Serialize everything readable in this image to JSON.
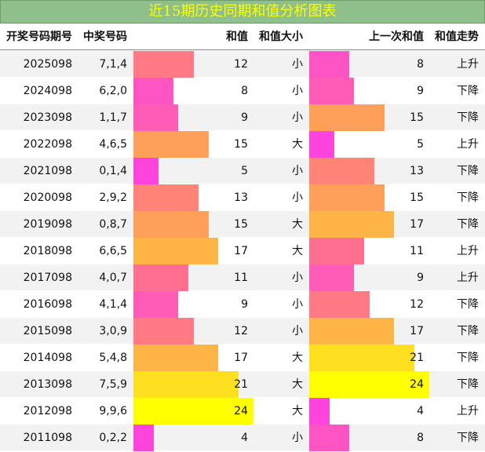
{
  "title": "近15期历史同期和值分析图表",
  "headers": {
    "period": "开奖号码期号",
    "numbers": "中奖号码",
    "sum": "和值",
    "size": "和值大小",
    "prev_sum": "上一次和值",
    "trend": "和值走势"
  },
  "bar_scale_max": 24,
  "rows": [
    {
      "period": "2025098",
      "numbers": "7,1,4",
      "sum": 12,
      "size": "小",
      "prev_sum": 8,
      "trend": "上升"
    },
    {
      "period": "2024098",
      "numbers": "6,2,0",
      "sum": 8,
      "size": "小",
      "prev_sum": 9,
      "trend": "下降"
    },
    {
      "period": "2023098",
      "numbers": "1,1,7",
      "sum": 9,
      "size": "小",
      "prev_sum": 15,
      "trend": "下降"
    },
    {
      "period": "2022098",
      "numbers": "4,6,5",
      "sum": 15,
      "size": "大",
      "prev_sum": 5,
      "trend": "上升"
    },
    {
      "period": "2021098",
      "numbers": "0,1,4",
      "sum": 5,
      "size": "小",
      "prev_sum": 13,
      "trend": "下降"
    },
    {
      "period": "2020098",
      "numbers": "2,9,2",
      "sum": 13,
      "size": "小",
      "prev_sum": 15,
      "trend": "下降"
    },
    {
      "period": "2019098",
      "numbers": "0,8,7",
      "sum": 15,
      "size": "大",
      "prev_sum": 17,
      "trend": "下降"
    },
    {
      "period": "2018098",
      "numbers": "6,6,5",
      "sum": 17,
      "size": "大",
      "prev_sum": 11,
      "trend": "上升"
    },
    {
      "period": "2017098",
      "numbers": "4,0,7",
      "sum": 11,
      "size": "小",
      "prev_sum": 9,
      "trend": "上升"
    },
    {
      "period": "2016098",
      "numbers": "4,1,4",
      "sum": 9,
      "size": "小",
      "prev_sum": 12,
      "trend": "下降"
    },
    {
      "period": "2015098",
      "numbers": "3,0,9",
      "sum": 12,
      "size": "小",
      "prev_sum": 17,
      "trend": "下降"
    },
    {
      "period": "2014098",
      "numbers": "5,4,8",
      "sum": 17,
      "size": "大",
      "prev_sum": 21,
      "trend": "下降"
    },
    {
      "period": "2013098",
      "numbers": "7,5,9",
      "sum": 21,
      "size": "大",
      "prev_sum": 24,
      "trend": "下降"
    },
    {
      "period": "2012098",
      "numbers": "9,9,6",
      "sum": 24,
      "size": "大",
      "prev_sum": 4,
      "trend": "上升"
    },
    {
      "period": "2011098",
      "numbers": "0,2,2",
      "sum": 4,
      "size": "小",
      "prev_sum": 8,
      "trend": "下降"
    }
  ],
  "colors": {
    "title_bg": "#8fbf8a",
    "title_text": "#ffff00",
    "row_alt_bg": "#f2f2f2",
    "bar_by_value": {
      "4": "#ff44dd",
      "5": "#ff44dd",
      "8": "#ff55c4",
      "9": "#ff5cb8",
      "11": "#ff6f8f",
      "12": "#ff7a85",
      "13": "#ff8477",
      "15": "#ffa05a",
      "17": "#ffb446",
      "21": "#ffe020",
      "24": "#ffff00"
    }
  }
}
